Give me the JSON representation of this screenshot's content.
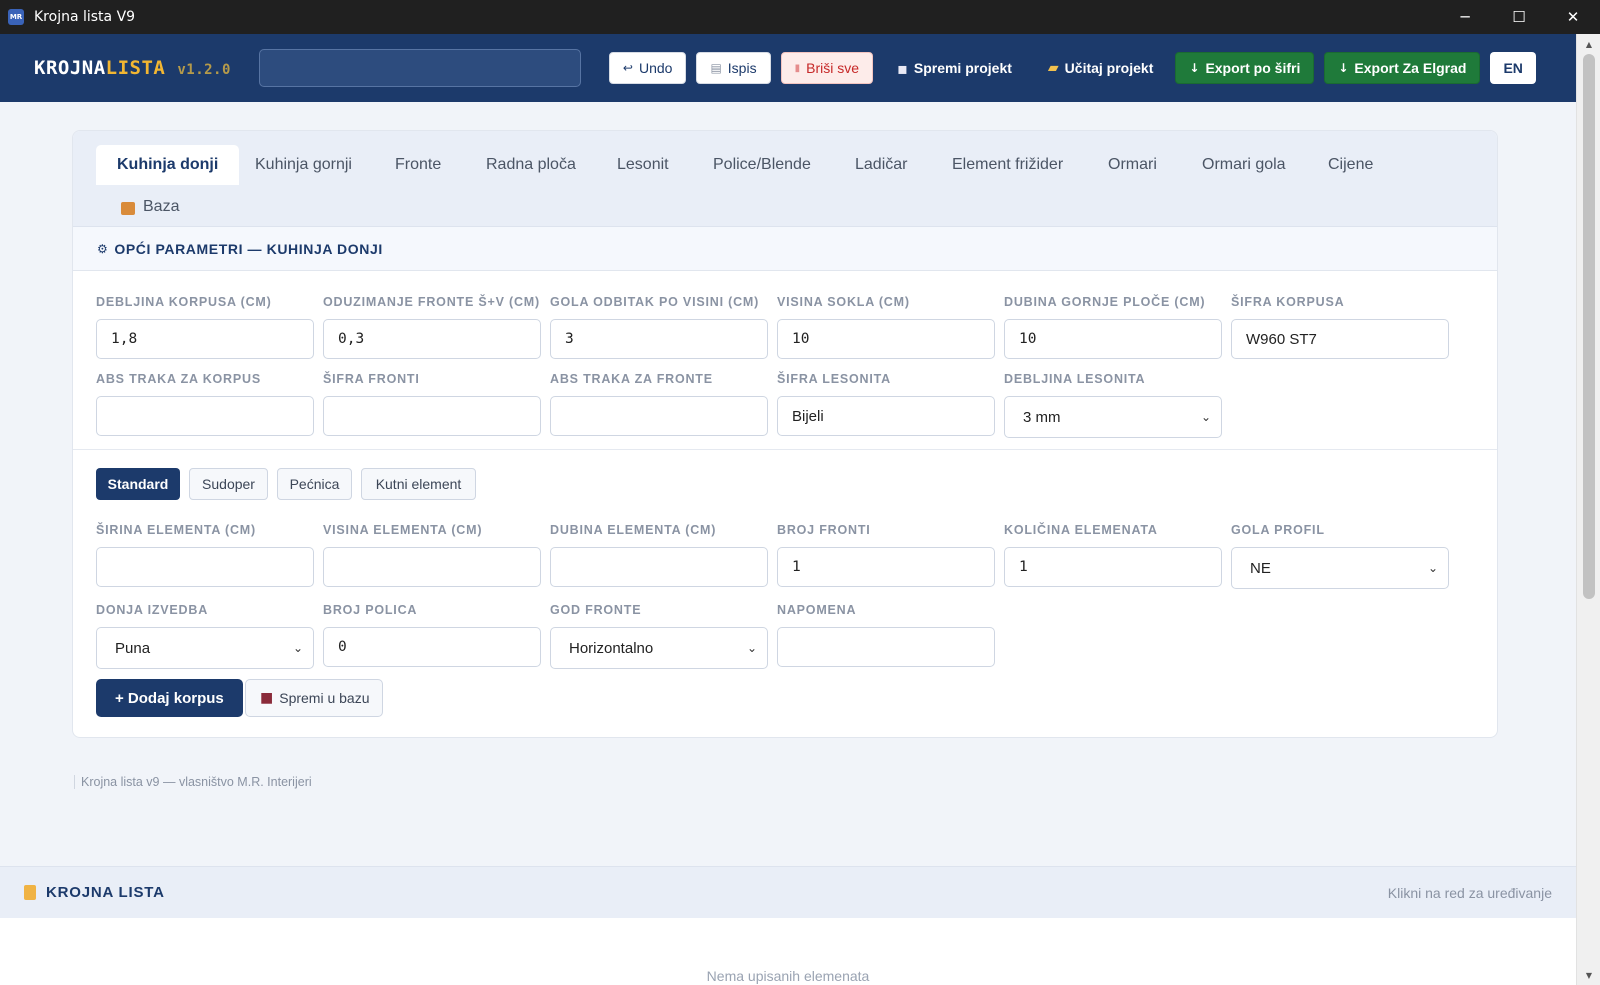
{
  "window": {
    "title": "Krojna lista V9",
    "app_icon_text": "MR",
    "minimize": "─",
    "maximize": "☐",
    "close": "✕"
  },
  "header": {
    "logo_part1": "KROJNA",
    "logo_part2": "LISTA",
    "version": "v1.2.0",
    "search_value": "",
    "buttons": {
      "undo": "Undo",
      "print": "Ispis",
      "delete_all": "Briši sve",
      "save_project": "Spremi projekt",
      "load_project": "Učitaj projekt",
      "export_code": "Export po šifri",
      "export_elgrad": "Export Za Elgrad",
      "language": "EN"
    },
    "icons": {
      "undo": "↩",
      "print": "▤",
      "delete": "▮",
      "save": "▪",
      "folder": "▰",
      "export": "↓"
    }
  },
  "tabs": [
    "Kuhinja donji",
    "Kuhinja gornji",
    "Fronte",
    "Radna ploča",
    "Lesonit",
    "Police/Blende",
    "Ladičar",
    "Element frižider",
    "Ormari",
    "Ormari gola",
    "Cijene",
    "Baza"
  ],
  "section": {
    "icon": "⚙",
    "title": "OPĆI PARAMETRI — KUHINJA DONJI"
  },
  "general": {
    "debljina_korpusa": {
      "label": "DEBLJINA KORPUSA (CM)",
      "value": "1,8"
    },
    "oduzimanje_fronte": {
      "label": "ODUZIMANJE FRONTE Š+V (CM)",
      "value": "0,3"
    },
    "gola_odbitak": {
      "label": "GOLA ODBITAK PO VISINI (CM)",
      "value": "3"
    },
    "visina_sokla": {
      "label": "VISINA SOKLA (CM)",
      "value": "10"
    },
    "dubina_gornje_ploce": {
      "label": "DUBINA GORNJE PLOČE (CM)",
      "value": "10"
    },
    "sifra_korpusa": {
      "label": "ŠIFRA KORPUSA",
      "value": "W960 ST7"
    },
    "abs_korpus": {
      "label": "ABS TRAKA ZA KORPUS",
      "value": ""
    },
    "sifra_fronti": {
      "label": "ŠIFRA FRONTI",
      "value": ""
    },
    "abs_fronte": {
      "label": "ABS TRAKA ZA FRONTE",
      "value": ""
    },
    "sifra_lesonita": {
      "label": "ŠIFRA LESONITA",
      "value": "Bijeli"
    },
    "debljina_lesonita": {
      "label": "DEBLJINA LESONITA",
      "value": "3 mm"
    }
  },
  "element_types": [
    "Standard",
    "Sudoper",
    "Pećnica",
    "Kutni element"
  ],
  "element": {
    "sirina": {
      "label": "ŠIRINA ELEMENTA (CM)",
      "value": ""
    },
    "visina": {
      "label": "VISINA ELEMENTA (CM)",
      "value": ""
    },
    "dubina": {
      "label": "DUBINA ELEMENTA (CM)",
      "value": ""
    },
    "broj_fronti": {
      "label": "BROJ FRONTI",
      "value": "1"
    },
    "kolicina": {
      "label": "KOLIČINA ELEMENATA",
      "value": "1"
    },
    "gola_profil": {
      "label": "GOLA PROFIL",
      "value": "NE"
    },
    "donja_izvedba": {
      "label": "DONJA IZVEDBA",
      "value": "Puna"
    },
    "broj_polica": {
      "label": "BROJ POLICA",
      "value": "0"
    },
    "god_fronte": {
      "label": "GOD FRONTE",
      "value": "Horizontalno"
    },
    "napomena": {
      "label": "NAPOMENA",
      "value": ""
    }
  },
  "actions": {
    "add": "+ Dodaj korpus",
    "save_db": "Spremi u bazu"
  },
  "footer": "Krojna lista v9 — vlasništvo M.R. Interijeri",
  "krojna": {
    "title": "KROJNA LISTA",
    "hint": "Klikni na red za uređivanje",
    "empty": "Nema upisanih elemenata"
  },
  "colors": {
    "primary": "#1c3a6b",
    "accent": "#f2b632",
    "green": "#1f7a3a",
    "danger": "#c62828"
  }
}
